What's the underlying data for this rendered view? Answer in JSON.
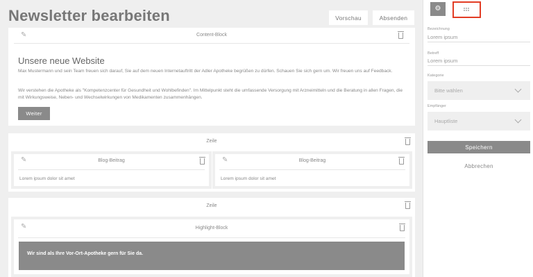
{
  "header": {
    "title": "Newsletter bearbeiten",
    "preview_label": "Vorschau",
    "send_label": "Absenden"
  },
  "content_block": {
    "caption": "Content-Block",
    "heading": "Unsere neue Website",
    "paragraph1": "Max Mustermann und sein Team freuen sich darauf, Sie auf dem neuen Internetauftritt der Adler Apotheke begrüßen zu dürfen. Schauen Sie sich gern um. Wir freuen uns auf Feedback.",
    "paragraph2": "Wir verstehen die Apotheke als \"Kompetenzcenter für Gesundheit und Wohlbefinden\". Im Mittelpunkt steht die umfassende Versorgung mit Arzneimitteln und die Beratung in allen Fragen, die mit Wirkungsweise, Neben- und Wechselwirkungen von Medikamenten zusammenhängen.",
    "button_label": "Weiter"
  },
  "row1": {
    "caption": "Zeile",
    "blocks": [
      {
        "caption": "Blog-Beitrag",
        "text": "Lorem ipsum dolor sit amet"
      },
      {
        "caption": "Blog-Beitrag",
        "text": "Lorem ipsum dolor sit amet"
      }
    ]
  },
  "row2": {
    "caption": "Zeile",
    "highlight": {
      "caption": "Highlight-Block",
      "text": "Wir sind als Ihre Vor-Ort-Apotheke gern für Sie da."
    }
  },
  "sidebar": {
    "fields": {
      "designation_label": "Bezeichnung",
      "designation_value": "Lorem ipsum",
      "subject_label": "Betreff",
      "subject_value": "Lorem ipsum",
      "category_label": "Kategorie",
      "category_value": "Bitte wählen",
      "recipient_label": "Empfänger",
      "recipient_value": "Hauptliste"
    },
    "save_label": "Speichern",
    "cancel_label": "Abbrechen"
  },
  "colors": {
    "accent_gray": "#8a8a8a",
    "highlight_frame": "#e23c24"
  }
}
